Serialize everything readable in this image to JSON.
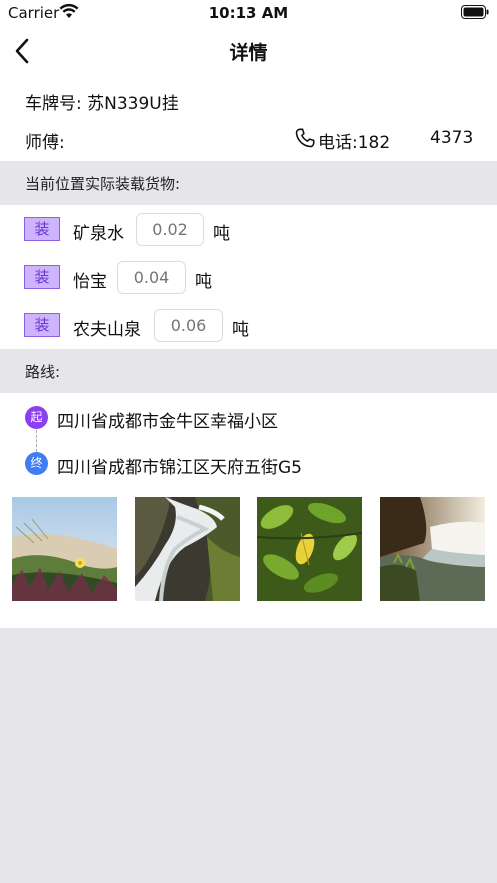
{
  "status_bar": {
    "carrier": "Carrier",
    "time": "10:13 AM"
  },
  "nav": {
    "title": "详情"
  },
  "info": {
    "plate": "车牌号: 苏N339U挂",
    "driver_label": "师傅:",
    "phone_label": "电话:182",
    "phone_suffix": "4373"
  },
  "goods_header": "当前位置实际装载货物:",
  "goods": [
    {
      "tag": "装",
      "name": "矿泉水",
      "qty_placeholder": "0.02",
      "unit": "吨"
    },
    {
      "tag": "装",
      "name": "怡宝",
      "qty_placeholder": "0.04",
      "unit": "吨"
    },
    {
      "tag": "装",
      "name": "农夫山泉",
      "qty_placeholder": "0.06",
      "unit": "吨"
    }
  ],
  "route_header": "路线:",
  "route": {
    "start_tag": "起",
    "start": "四川省成都市金牛区幸福小区",
    "end_tag": "终",
    "end": "四川省成都市锦江区天府五街G5"
  },
  "photos": [
    {
      "icon": "photo-flowers-dune"
    },
    {
      "icon": "photo-waterfall-rocks"
    },
    {
      "icon": "photo-green-leaves"
    },
    {
      "icon": "photo-waterfall-cliff"
    }
  ],
  "colors": {
    "tag_bg": "#cdb4fb",
    "tag_border": "#8c5fe8",
    "start_dot": "#8a3ff0",
    "end_dot": "#3f7cf5",
    "section_bg": "#e5e5ea"
  }
}
